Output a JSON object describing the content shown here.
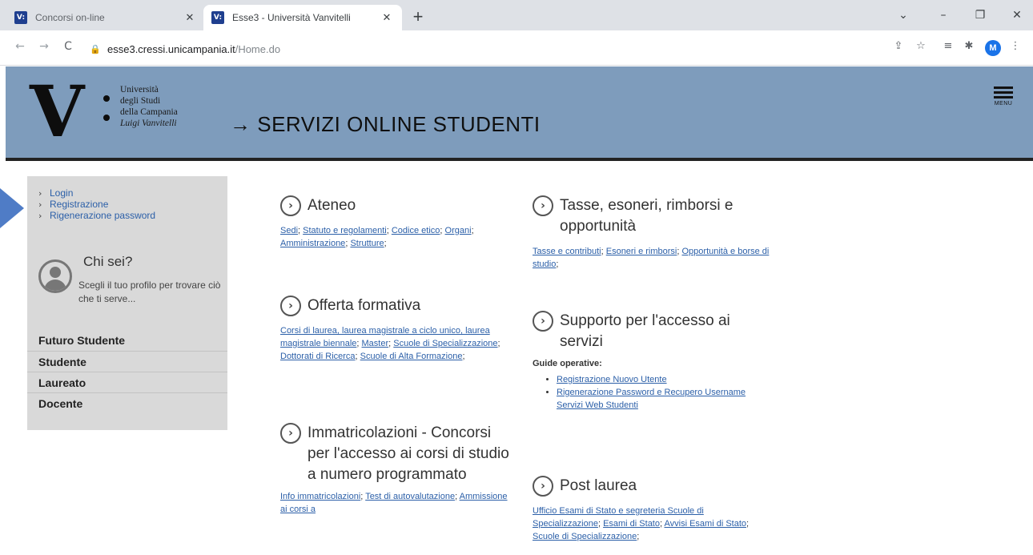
{
  "browser": {
    "tabs": [
      {
        "title": "Concorsi on-line",
        "favicon": "V:",
        "active": false
      },
      {
        "title": "Esse3 - Università Vanvitelli",
        "favicon": "V:",
        "active": true
      }
    ],
    "new_tab": "+",
    "window_controls": {
      "chevron": "⌄",
      "minimize": "–",
      "restore": "❐",
      "close": "✕"
    },
    "nav": {
      "back": "←",
      "forward": "→",
      "reload": "C"
    },
    "url": {
      "lock": "🔒",
      "host": "esse3.cressi.unicampania.it",
      "path": "/Home.do"
    },
    "toolbar_icons": {
      "share": "⇪",
      "star": "☆",
      "media": "≡",
      "extensions": "✱",
      "menu": "⋮"
    },
    "profile_initial": "M"
  },
  "header": {
    "logo": {
      "letter": "V",
      "lines": [
        "Università",
        "degli Studi",
        "della Campania",
        "Luigi Vanvitelli"
      ]
    },
    "title_arrow": "→",
    "title": "SERVIZI ONLINE STUDENTI",
    "menu_label": "MENU"
  },
  "sidebar": {
    "links": [
      {
        "chevron": "›",
        "label": "Login"
      },
      {
        "chevron": "›",
        "label": "Registrazione"
      },
      {
        "chevron": "›",
        "label": "Rigenerazione password"
      }
    ],
    "who_title": "Chi sei?",
    "who_desc": "Scegli il tuo profilo per trovare ciò che ti serve...",
    "profiles": [
      "Futuro Studente",
      "Studente",
      "Laureato",
      "Docente"
    ]
  },
  "sections": {
    "icon": "›",
    "ateneo": {
      "title": "Ateneo",
      "links": [
        "Sedi",
        "Statuto e regolamenti",
        "Codice etico",
        "Organi",
        "Amministrazione",
        "Strutture"
      ]
    },
    "offerta": {
      "title": "Offerta formativa",
      "links": [
        "Corsi di laurea, laurea magistrale a ciclo unico, laurea magistrale biennale",
        "Master",
        "Scuole di Specializzazione",
        "Dottorati di Ricerca",
        "Scuole di Alta Formazione"
      ]
    },
    "immatricolazioni": {
      "title": "Immatricolazioni - Concorsi per l'accesso ai corsi di studio a numero programmato",
      "links": [
        "Info immatricolazioni",
        "Test di autovalutazione",
        "Ammissione ai corsi a"
      ]
    },
    "tasse": {
      "title": "Tasse, esoneri, rimborsi e opportunità",
      "links": [
        "Tasse e contributi",
        "Esoneri e rimborsi",
        "Opportunità e borse di studio"
      ]
    },
    "supporto": {
      "title": "Supporto per l'accesso ai servizi",
      "guide_title": "Guide operative:",
      "guides": [
        "Registrazione Nuovo Utente",
        "Rigenerazione Password e Recupero Username Servizi Web Studenti"
      ]
    },
    "post": {
      "title": "Post laurea",
      "links": [
        "Ufficio Esami di Stato e segreteria Scuole di Specializzazione",
        "Esami di Stato",
        "Avvisi Esami di Stato",
        "Scuole di Specializzazione"
      ]
    },
    "separator": ";"
  }
}
